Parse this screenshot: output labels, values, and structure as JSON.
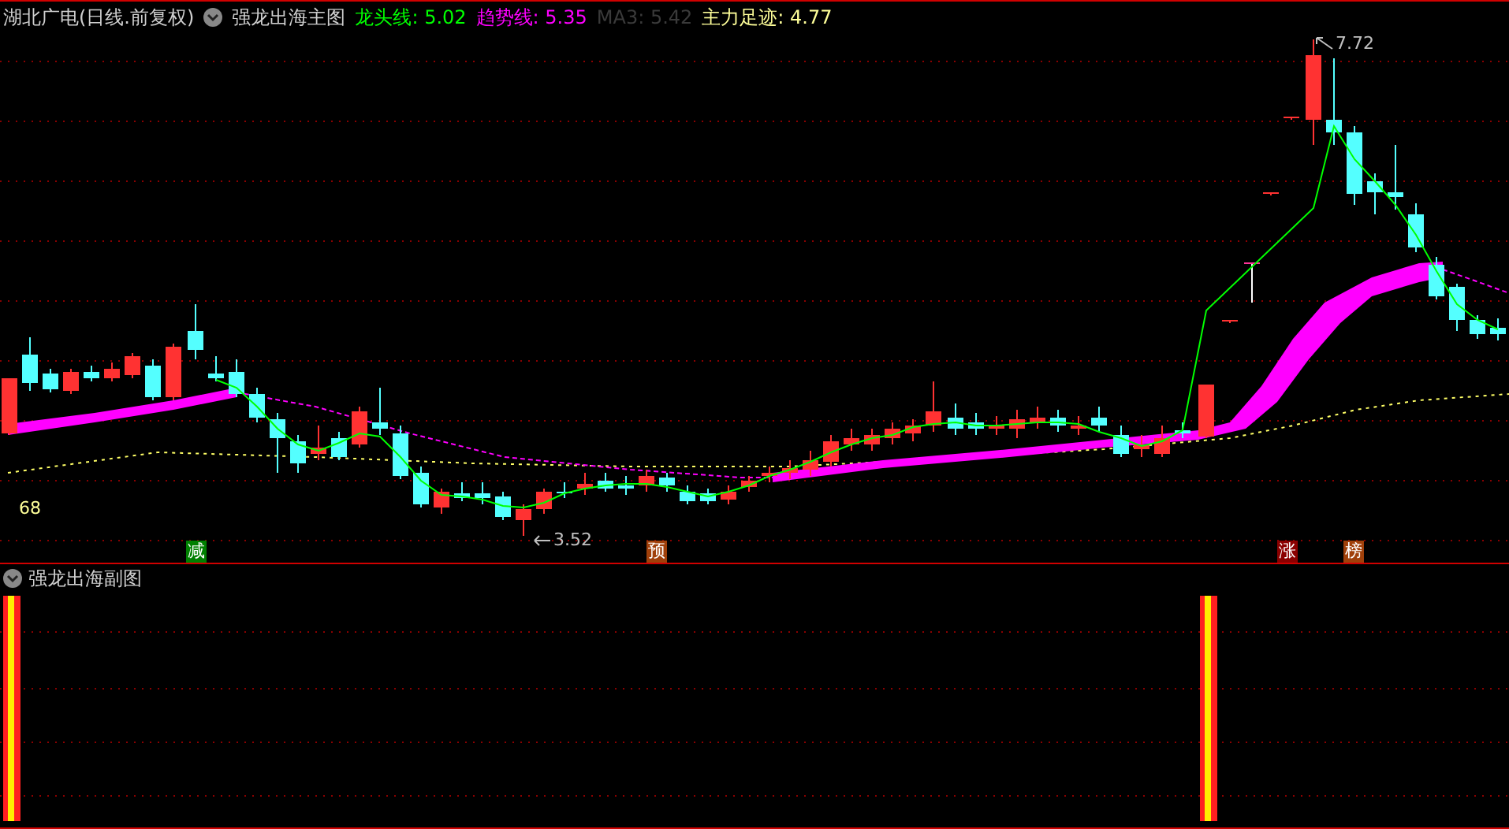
{
  "header": {
    "title": "湖北广电(日线.前复权)",
    "indicator": "强龙出海主图",
    "legend": [
      {
        "label": "龙头线:",
        "value": "5.02",
        "color": "#00ff00"
      },
      {
        "label": "趋势线:",
        "value": "5.35",
        "color": "#ff00ff"
      },
      {
        "label": "MA3:",
        "value": "5.42",
        "color": "#3a3a3a"
      },
      {
        "label": "主力足迹:",
        "value": "4.77",
        "color": "#ffff99"
      }
    ]
  },
  "main_chart": {
    "level_label": "68",
    "high_label": "7.72",
    "low_label": "3.52",
    "signals": [
      {
        "text": "减",
        "color": "#008000"
      },
      {
        "text": "预",
        "color": "#a0400a"
      },
      {
        "text": "涨",
        "color": "#8b0000"
      },
      {
        "text": "榜",
        "color": "#a0400a"
      }
    ]
  },
  "sub_panel": {
    "title": "强龙出海副图"
  }
}
